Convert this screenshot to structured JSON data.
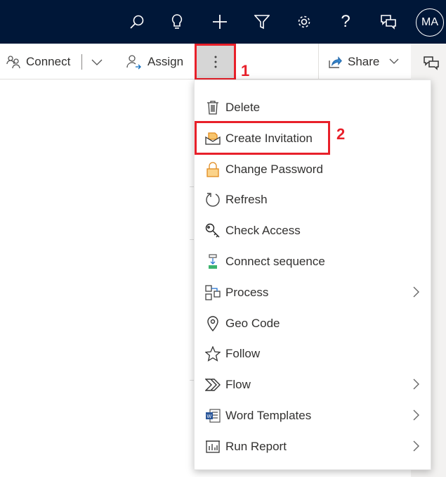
{
  "header": {
    "avatar_initials": "MA",
    "icons": [
      "search-icon",
      "lightbulb-icon",
      "plus-icon",
      "filter-icon",
      "gear-icon",
      "help-icon",
      "chat-icon"
    ]
  },
  "toolbar": {
    "connect_label": "Connect",
    "assign_label": "Assign",
    "share_label": "Share"
  },
  "annotations": {
    "step1": "1",
    "step2": "2",
    "highlight_color": "#e8202a"
  },
  "menu": {
    "items": [
      {
        "label": "Delete",
        "icon": "trash-icon",
        "submenu": false
      },
      {
        "label": "Create Invitation",
        "icon": "invitation-icon",
        "submenu": false
      },
      {
        "label": "Change Password",
        "icon": "lock-icon",
        "submenu": false
      },
      {
        "label": "Refresh",
        "icon": "refresh-icon",
        "submenu": false
      },
      {
        "label": "Check Access",
        "icon": "key-icon",
        "submenu": false
      },
      {
        "label": "Connect sequence",
        "icon": "sequence-icon",
        "submenu": false
      },
      {
        "label": "Process",
        "icon": "process-icon",
        "submenu": true
      },
      {
        "label": "Geo Code",
        "icon": "location-pin-icon",
        "submenu": false
      },
      {
        "label": "Follow",
        "icon": "star-icon",
        "submenu": false
      },
      {
        "label": "Flow",
        "icon": "flow-icon",
        "submenu": true
      },
      {
        "label": "Word Templates",
        "icon": "word-icon",
        "submenu": true
      },
      {
        "label": "Run Report",
        "icon": "report-icon",
        "submenu": true
      }
    ]
  }
}
